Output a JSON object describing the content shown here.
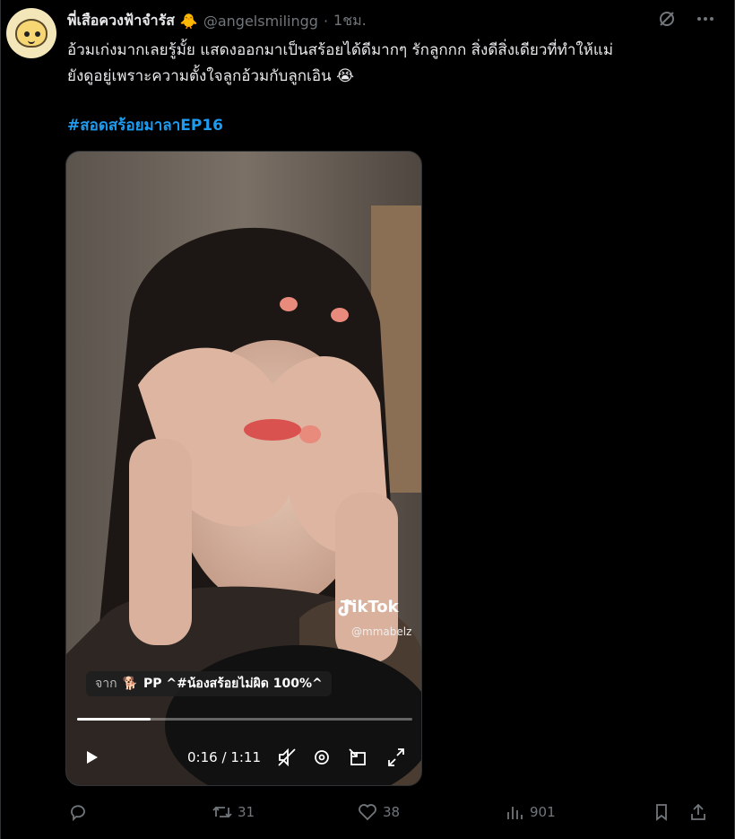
{
  "tweet": {
    "display_name": "พี่เสือควงฟ้าจำรัส",
    "name_emoji": "🐥",
    "handle": "@angelsmilingg",
    "separator": "·",
    "time": "1ชม.",
    "text_line1": "อ้วมเก่งมากเลยรู้มั้ย แสดงออกมาเป็นสร้อยได้ดีมากๆ รักลูกกก สิ่งดีสิ่งเดียวที่ทำให้แม่",
    "text_line2": "ยังดูอยู่เพราะความตั้งใจลูกอ้วมกับลูกเอิน 😭",
    "hashtag": "#สอดสร้อยมาลาEP16"
  },
  "video": {
    "watermark_brand": "TikTok",
    "watermark_user": "@mmabelz",
    "caption_from": "จาก",
    "caption_emoji": "🐕",
    "caption_text": "PP ^#น้องสร้อยไม่ผิด 100%^",
    "time_current": "0:16",
    "time_separator": "/",
    "time_total": "1:11",
    "progress_fraction": 0.22
  },
  "actions": {
    "reply_icon": "reply-icon",
    "retweet_count": "31",
    "like_count": "38",
    "views_count": "901"
  },
  "colors": {
    "accent": "#1d9bf0",
    "muted": "#71767b",
    "text": "#e7e9ea",
    "background": "#000000"
  }
}
